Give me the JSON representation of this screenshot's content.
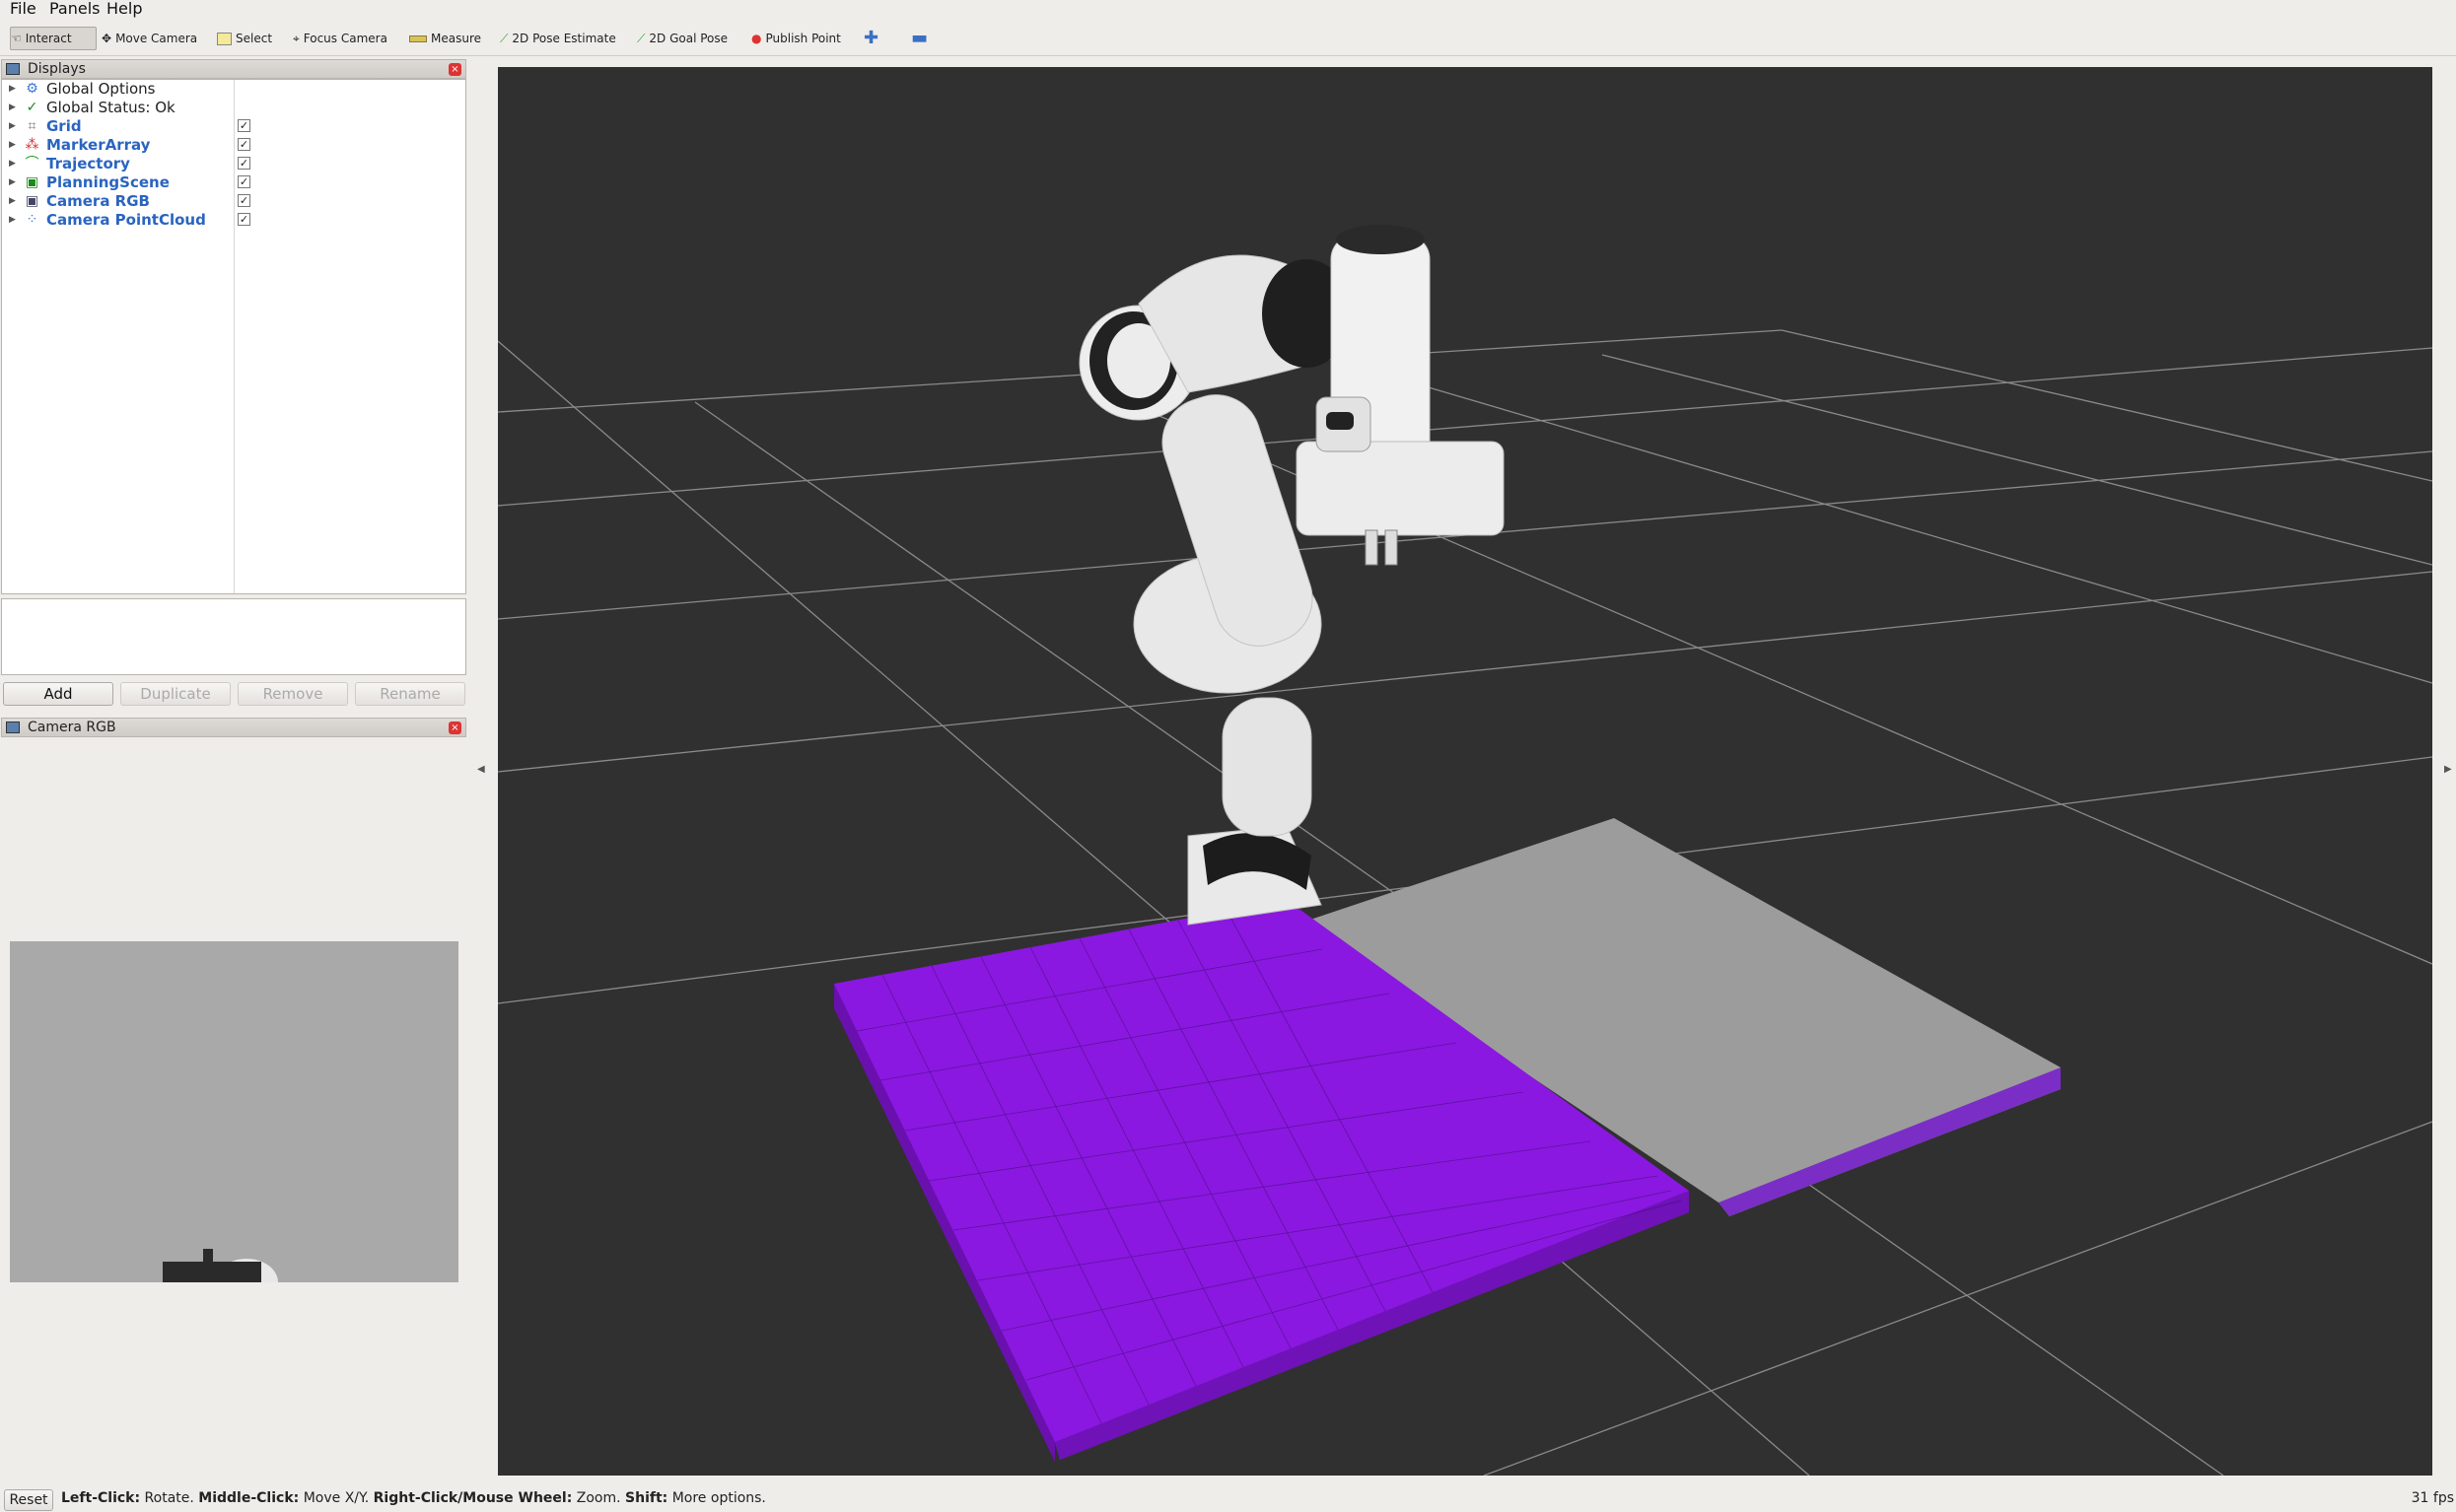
{
  "menu": {
    "file": "File",
    "panels": "Panels",
    "help": "Help"
  },
  "toolbar": {
    "interact": "Interact",
    "move_camera": "Move Camera",
    "select": "Select",
    "focus_camera": "Focus Camera",
    "measure": "Measure",
    "pose_estimate": "2D Pose Estimate",
    "goal_pose": "2D Goal Pose",
    "publish_point": "Publish Point",
    "add_tool_icon": "plus-icon",
    "remove_tool_icon": "minus-icon"
  },
  "displays_panel": {
    "title": "Displays",
    "items": [
      {
        "label": "Global Options",
        "icon": "gear-icon",
        "checked": null
      },
      {
        "label": "Global Status: Ok",
        "icon": "check-icon",
        "checked": null
      },
      {
        "label": "Grid",
        "icon": "grid-icon",
        "checked": true
      },
      {
        "label": "MarkerArray",
        "icon": "marker-icon",
        "checked": true
      },
      {
        "label": "Trajectory",
        "icon": "trajectory-icon",
        "checked": true
      },
      {
        "label": "PlanningScene",
        "icon": "planning-scene-icon",
        "checked": true
      },
      {
        "label": "Camera RGB",
        "icon": "camera-icon",
        "checked": true
      },
      {
        "label": "Camera PointCloud",
        "icon": "pointcloud-icon",
        "checked": true
      }
    ],
    "buttons": {
      "add": "Add",
      "duplicate": "Duplicate",
      "remove": "Remove",
      "rename": "Rename"
    }
  },
  "camera_panel": {
    "title": "Camera RGB"
  },
  "status": {
    "reset": "Reset",
    "lc_key": "Left-Click:",
    "lc_val": " Rotate. ",
    "mc_key": "Middle-Click:",
    "mc_val": " Move X/Y. ",
    "rc_key": "Right-Click/Mouse Wheel:",
    "rc_val": " Zoom. ",
    "sh_key": "Shift:",
    "sh_val": " More options.",
    "fps": "31 fps"
  },
  "colors": {
    "voxel": "#8a1ae0",
    "table": "#9a9a9a",
    "viewport_bg": "#303030",
    "link": "#2a64c0"
  }
}
